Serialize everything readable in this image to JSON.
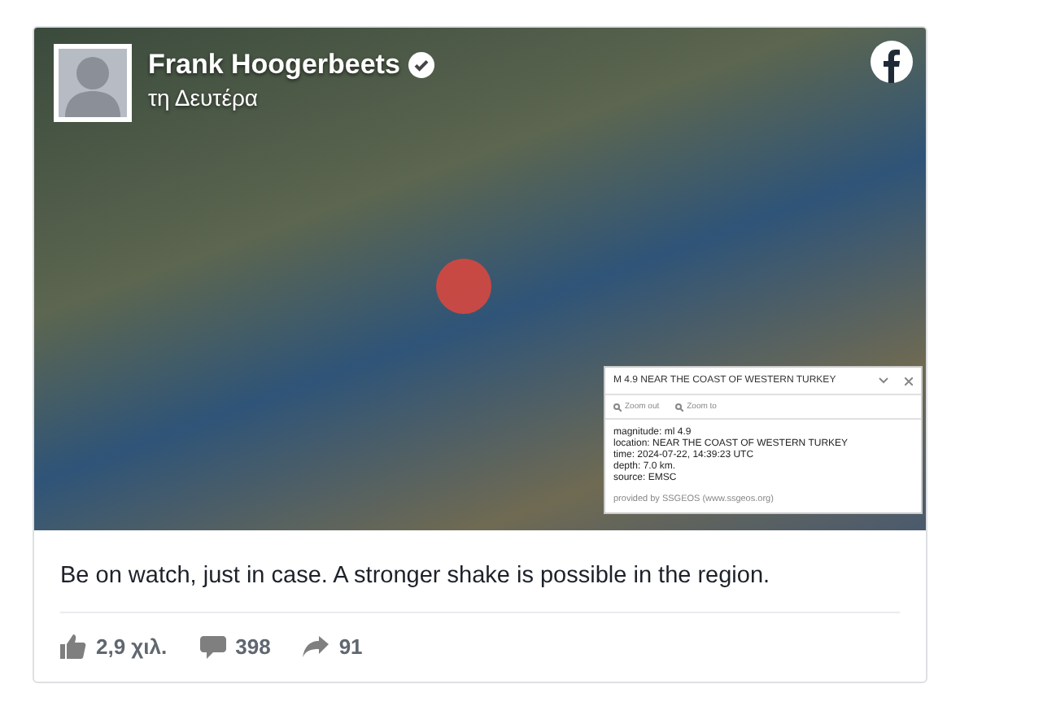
{
  "post": {
    "author": "Frank Hoogerbeets",
    "verified": true,
    "time": "τη Δευτέρα",
    "image": {
      "popup": {
        "title": "M 4.9 NEAR THE COAST OF WESTERN TURKEY",
        "actions": [
          "Zoom out",
          "Zoom to"
        ],
        "details": [
          "magnitude: ml 4.9",
          "location: NEAR THE COAST OF WESTERN TURKEY",
          "time: 2024-07-22, 14:39:23 UTC",
          "depth: 7.0 km.",
          "source: EMSC"
        ],
        "footer": "provided by SSGEOS (www.ssgeos.org)"
      }
    },
    "text": "Be on watch, just in case. A stronger shake is possible in the region.",
    "stats": [
      {
        "kind": "likes",
        "value": "2,9 χιλ."
      },
      {
        "kind": "comments",
        "value": "398"
      },
      {
        "kind": "shares",
        "value": "91"
      }
    ]
  }
}
